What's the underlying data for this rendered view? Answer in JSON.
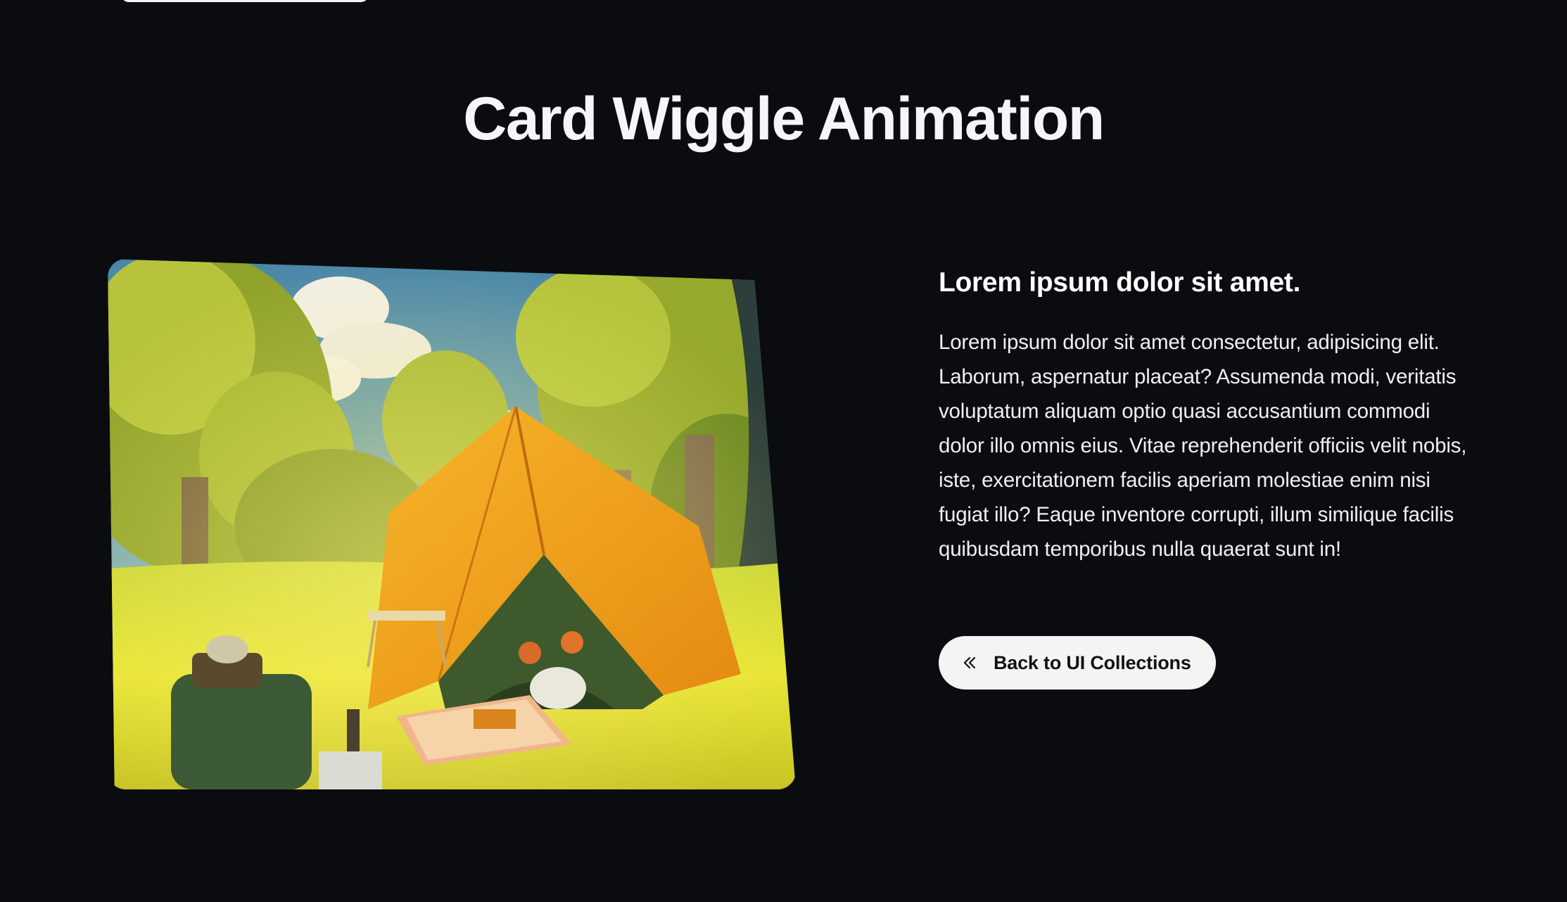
{
  "header": {
    "title": "Card Wiggle Animation"
  },
  "card": {
    "image_description_icon": "camping-illustration-image"
  },
  "content": {
    "heading": "Lorem ipsum dolor sit amet.",
    "body": "Lorem ipsum dolor sit amet consectetur, adipisicing elit. Laborum, aspernatur placeat? Assumenda modi, veritatis voluptatum aliquam optio quasi accusantium commodi dolor illo omnis eius. Vitae reprehenderit officiis velit nobis, iste, exercitationem facilis aperiam molestiae enim nisi fugiat illo? Eaque inventore corrupti, illum similique facilis quibusdam temporibus nulla quaerat sunt in!"
  },
  "back_button": {
    "label": "Back to UI Collections",
    "icon": "double-chevron-left-icon"
  },
  "colors": {
    "background": "#0a0c0f",
    "text": "#f2f4f5",
    "button_bg": "#f4f5f3",
    "button_text": "#101214",
    "tent": "#f2a21c",
    "foliage": "#a8b828"
  }
}
